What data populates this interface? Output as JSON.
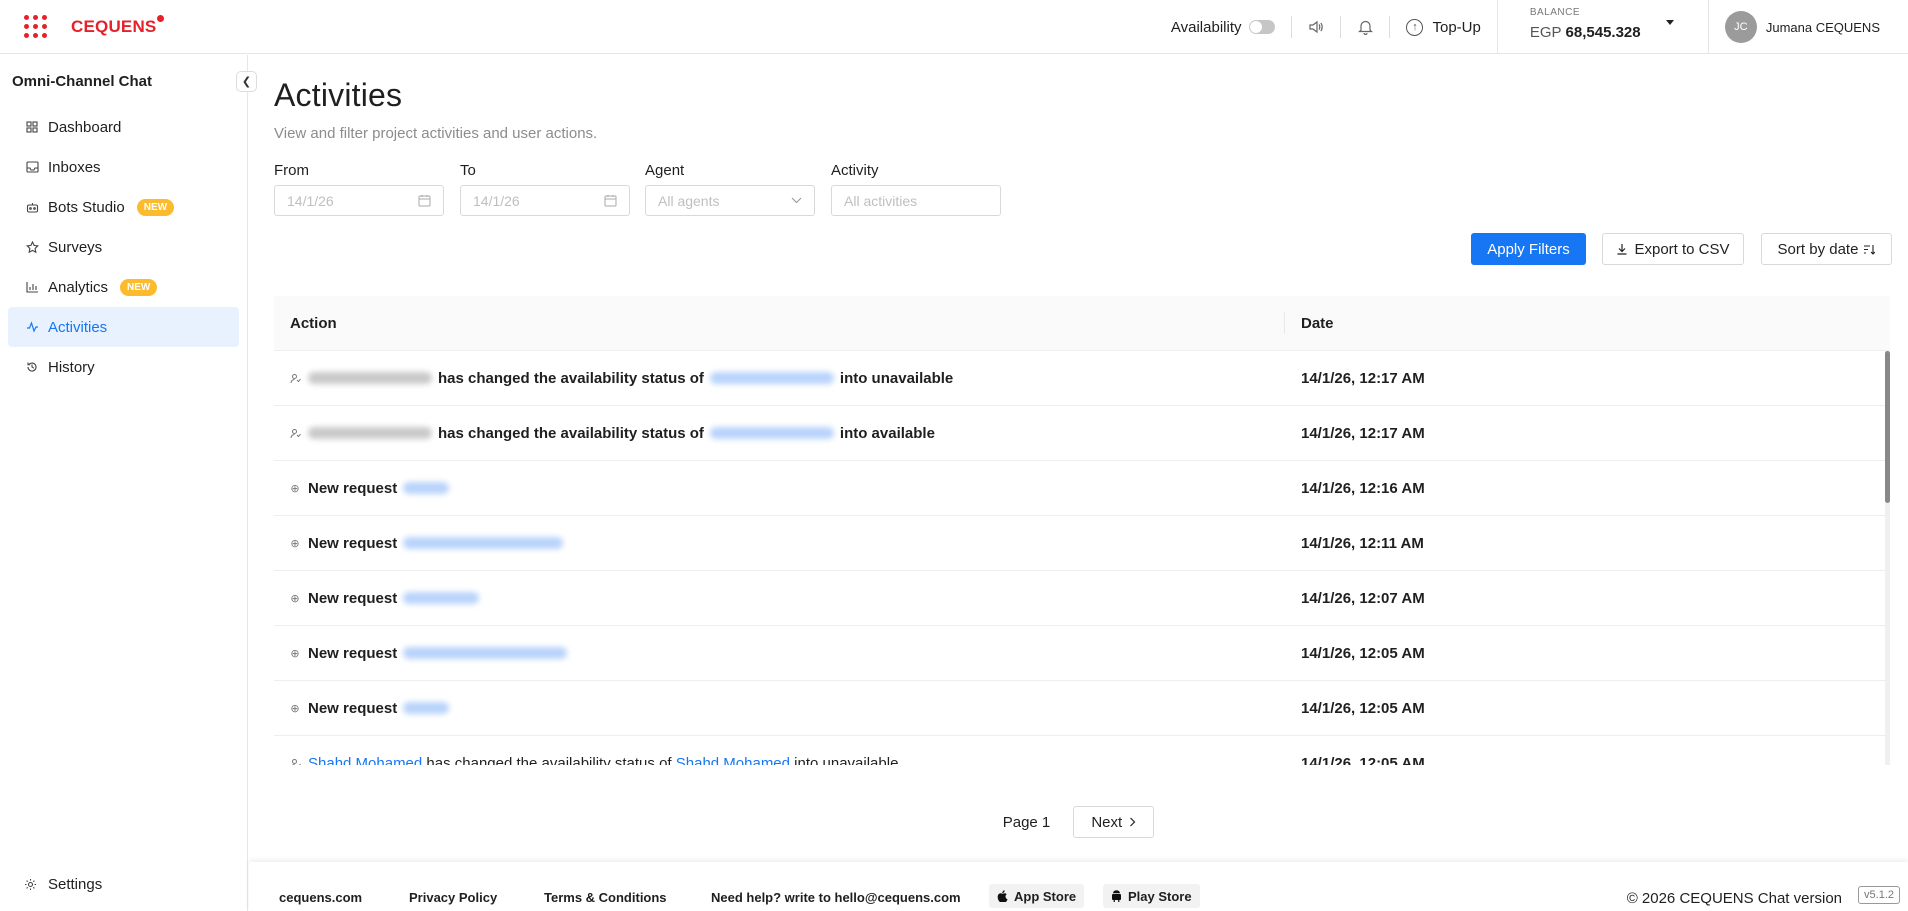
{
  "brand": {
    "name": "CEQUENS",
    "color": "#e5222a"
  },
  "topbar": {
    "availability_label": "Availability",
    "topup_label": "Top-Up",
    "balance_label": "BALANCE",
    "balance_currency": "EGP",
    "balance_value": "68,545.328",
    "user_initials": "JC",
    "user_name": "Jumana CEQUENS"
  },
  "sidebar": {
    "title": "Omni-Channel Chat",
    "items": [
      {
        "label": "Dashboard",
        "icon": "dashboard-icon"
      },
      {
        "label": "Inboxes",
        "icon": "inbox-icon"
      },
      {
        "label": "Bots Studio",
        "icon": "bot-icon",
        "badge": "NEW"
      },
      {
        "label": "Surveys",
        "icon": "star-icon"
      },
      {
        "label": "Analytics",
        "icon": "bar-chart-icon",
        "badge": "NEW"
      },
      {
        "label": "Activities",
        "icon": "activity-icon",
        "active": true
      },
      {
        "label": "History",
        "icon": "history-icon"
      }
    ],
    "settings_label": "Settings"
  },
  "page": {
    "title": "Activities",
    "subtitle": "View and filter project activities and user actions."
  },
  "filters": {
    "from_label": "From",
    "from_placeholder": "14/1/26",
    "to_label": "To",
    "to_placeholder": "14/1/26",
    "agent_label": "Agent",
    "agent_placeholder": "All agents",
    "activity_label": "Activity",
    "activity_placeholder": "All activities",
    "apply_label": "Apply Filters",
    "export_label": "Export to CSV",
    "sort_label": "Sort by date"
  },
  "table": {
    "headers": {
      "action": "Action",
      "date": "Date"
    },
    "rows": [
      {
        "type": "status",
        "text": "has changed the availability status of",
        "suffix": "into unavailable",
        "date": "14/1/26, 12:17 AM"
      },
      {
        "type": "status",
        "text": "has changed the availability status of",
        "suffix": "into available",
        "date": "14/1/26, 12:17 AM"
      },
      {
        "type": "request",
        "text": "New request",
        "date": "14/1/26, 12:16 AM"
      },
      {
        "type": "request",
        "text": "New request",
        "date": "14/1/26, 12:11 AM"
      },
      {
        "type": "request",
        "text": "New request",
        "date": "14/1/26, 12:07 AM"
      },
      {
        "type": "request",
        "text": "New request",
        "date": "14/1/26, 12:05 AM"
      },
      {
        "type": "request",
        "text": "New request",
        "date": "14/1/26, 12:05 AM"
      },
      {
        "type": "status-partial",
        "agent": "Shahd Mohamed",
        "text": "has changed the availability status of",
        "target": "Shahd Mohamed",
        "suffix": "into unavailable",
        "date": "14/1/26, 12:05 AM"
      }
    ]
  },
  "pagination": {
    "page_label": "Page 1",
    "next_label": "Next"
  },
  "footer": {
    "site": "cequens.com",
    "privacy": "Privacy Policy",
    "terms": "Terms & Conditions",
    "help": "Need help? write to hello@cequens.com",
    "app_store": "App Store",
    "play_store": "Play Store",
    "copyright": "© 2026 CEQUENS Chat version",
    "version": "v5.1.2"
  },
  "colors": {
    "accent": "#1676f3",
    "badge": "#fbbb2c",
    "active_bg": "#e8f2ff"
  }
}
